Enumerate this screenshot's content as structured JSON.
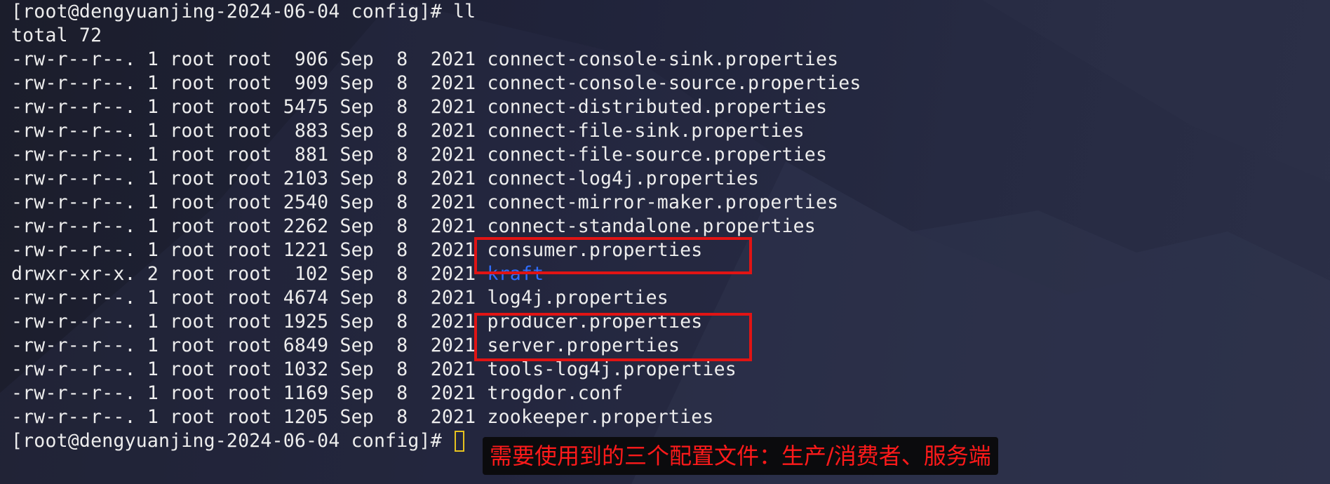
{
  "terminal": {
    "prompt_command": "[root@dengyuanjing-2024-06-04 config]# ll",
    "total": "total 72",
    "rows": [
      {
        "text": "-rw-r--r--. 1 root root  906 Sep  8  2021 ",
        "name": "connect-console-sink.properties"
      },
      {
        "text": "-rw-r--r--. 1 root root  909 Sep  8  2021 ",
        "name": "connect-console-source.properties"
      },
      {
        "text": "-rw-r--r--. 1 root root 5475 Sep  8  2021 ",
        "name": "connect-distributed.properties"
      },
      {
        "text": "-rw-r--r--. 1 root root  883 Sep  8  2021 ",
        "name": "connect-file-sink.properties"
      },
      {
        "text": "-rw-r--r--. 1 root root  881 Sep  8  2021 ",
        "name": "connect-file-source.properties"
      },
      {
        "text": "-rw-r--r--. 1 root root 2103 Sep  8  2021 ",
        "name": "connect-log4j.properties"
      },
      {
        "text": "-rw-r--r--. 1 root root 2540 Sep  8  2021 ",
        "name": "connect-mirror-maker.properties"
      },
      {
        "text": "-rw-r--r--. 1 root root 2262 Sep  8  2021 ",
        "name": "connect-standalone.properties"
      },
      {
        "text": "-rw-r--r--. 1 root root 1221 Sep  8  2021 ",
        "name": "consumer.properties"
      },
      {
        "text": "drwxr-xr-x. 2 root root  102 Sep  8  2021 ",
        "name": "kraft"
      },
      {
        "text": "-rw-r--r--. 1 root root 4674 Sep  8  2021 ",
        "name": "log4j.properties"
      },
      {
        "text": "-rw-r--r--. 1 root root 1925 Sep  8  2021 ",
        "name": "producer.properties"
      },
      {
        "text": "-rw-r--r--. 1 root root 6849 Sep  8  2021 ",
        "name": "server.properties"
      },
      {
        "text": "-rw-r--r--. 1 root root 1032 Sep  8  2021 ",
        "name": "tools-log4j.properties"
      },
      {
        "text": "-rw-r--r--. 1 root root 1169 Sep  8  2021 ",
        "name": "trogdor.conf"
      },
      {
        "text": "-rw-r--r--. 1 root root 1205 Sep  8  2021 ",
        "name": "zookeeper.properties"
      }
    ],
    "final_prompt": "[root@dengyuanjing-2024-06-04 config]# "
  },
  "annotation": {
    "text": "需要使用到的三个配置文件：生产/消费者、服务端"
  },
  "colors": {
    "highlight": "#e11414",
    "directory": "#2f6dff",
    "cursor": "#e6c21f",
    "annotation_text": "#ff1a1a"
  }
}
